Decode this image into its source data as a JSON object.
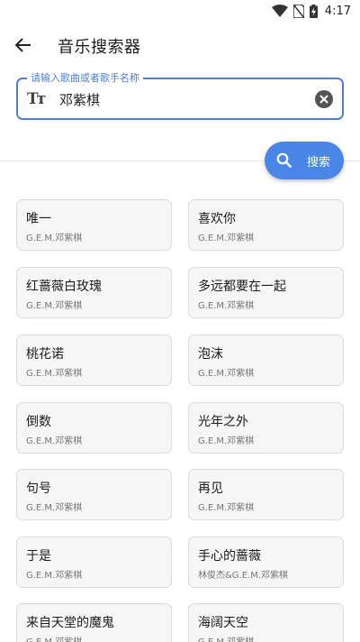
{
  "status_bar": {
    "time": "4:17"
  },
  "app_bar": {
    "title": "音乐搜索器"
  },
  "search": {
    "legend": "请输入歌曲或者歌手名称",
    "value": "邓紫棋",
    "type_icon_text": "Tт",
    "button_label": "搜索"
  },
  "colors": {
    "accent": "#4a86e8",
    "field_border": "#4f7fd1",
    "card_bg": "#f6f6f6"
  },
  "songs": [
    {
      "title": "唯一",
      "artist": "G.E.M.邓紫棋"
    },
    {
      "title": "喜欢你",
      "artist": "G.E.M.邓紫棋"
    },
    {
      "title": "红蔷薇白玫瑰",
      "artist": "G.E.M.邓紫棋"
    },
    {
      "title": "多远都要在一起",
      "artist": "G.E.M.邓紫棋"
    },
    {
      "title": "桃花诺",
      "artist": "G.E.M.邓紫棋"
    },
    {
      "title": "泡沫",
      "artist": "G.E.M.邓紫棋"
    },
    {
      "title": "倒数",
      "artist": "G.E.M.邓紫棋"
    },
    {
      "title": "光年之外",
      "artist": "G.E.M.邓紫棋"
    },
    {
      "title": "句号",
      "artist": "G.E.M.邓紫棋"
    },
    {
      "title": "再见",
      "artist": "G.E.M.邓紫棋"
    },
    {
      "title": "于是",
      "artist": "G.E.M.邓紫棋"
    },
    {
      "title": "手心的蔷薇",
      "artist": "林俊杰&G.E.M.邓紫棋"
    },
    {
      "title": "来自天堂的魔鬼",
      "artist": "G.E.M.邓紫棋"
    },
    {
      "title": "海阔天空",
      "artist": "G.E.M.邓紫棋"
    }
  ]
}
